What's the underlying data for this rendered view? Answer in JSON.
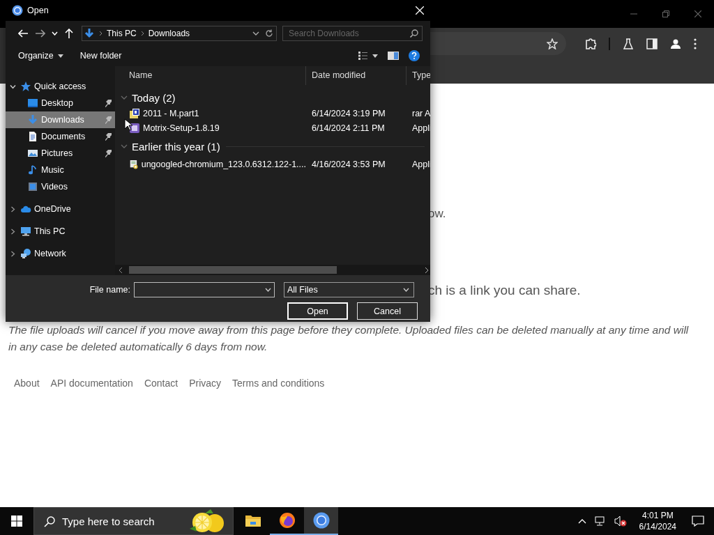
{
  "browser": {
    "page": {
      "fragments": [
        "ow.",
        "ch is a link you can share."
      ],
      "notice": "The file uploads will cancel if you move away from this page before they complete. Uploaded files can be deleted manually at any time and will in any case be deleted automatically 6 days from now.",
      "footer_links": [
        "About",
        "API documentation",
        "Contact",
        "Privacy",
        "Terms and conditions"
      ]
    }
  },
  "dialog": {
    "title": "Open",
    "breadcrumb": [
      "This PC",
      "Downloads"
    ],
    "search": {
      "placeholder": "Search Downloads"
    },
    "toolbar": [
      "Organize",
      "New folder"
    ],
    "nav": [
      {
        "label": "Quick access",
        "kind": "star",
        "expanded": true,
        "selected": false,
        "children": [
          {
            "label": "Desktop",
            "kind": "desktop",
            "pinned": true,
            "selected": false
          },
          {
            "label": "Downloads",
            "kind": "download",
            "pinned": true,
            "selected": true
          },
          {
            "label": "Documents",
            "kind": "document",
            "pinned": true,
            "selected": false
          },
          {
            "label": "Pictures",
            "kind": "picture",
            "pinned": true,
            "selected": false
          },
          {
            "label": "Music",
            "kind": "music",
            "pinned": false,
            "selected": false
          },
          {
            "label": "Videos",
            "kind": "video",
            "pinned": false,
            "selected": false
          }
        ]
      },
      {
        "label": "OneDrive",
        "kind": "cloud",
        "expanded": false,
        "selected": false
      },
      {
        "label": "This PC",
        "kind": "computer",
        "expanded": false,
        "selected": false
      },
      {
        "label": "Network",
        "kind": "network",
        "expanded": false,
        "selected": false
      }
    ],
    "columns": [
      "Name",
      "Date modified",
      "Type"
    ],
    "groups": [
      {
        "label": "Today (2)",
        "expanded": true,
        "files": [
          {
            "name": "2011 - M.part1",
            "kind": "archive",
            "date": "6/14/2024 3:19 PM",
            "type": "rar A",
            "selected": false
          },
          {
            "name": "Motrix-Setup-1.8.19",
            "kind": "installer",
            "date": "6/14/2024 2:11 PM",
            "type": "Appli",
            "selected": false
          }
        ]
      },
      {
        "label": "Earlier this year (1)",
        "expanded": true,
        "files": [
          {
            "name": "ungoogled-chromium_123.0.6312.122-1....",
            "kind": "setup",
            "date": "4/16/2024 3:53 PM",
            "type": "Appli",
            "selected": false
          }
        ]
      }
    ],
    "file_name_label": "File name:",
    "filter": "All Files",
    "buttons": [
      "Open",
      "Cancel"
    ]
  },
  "taskbar": {
    "search": {
      "placeholder": "Type here to search"
    },
    "apps": [
      {
        "kind": "folder",
        "running": false,
        "active": false
      },
      {
        "kind": "firefox",
        "running": true,
        "active": false
      },
      {
        "kind": "chrome",
        "running": true,
        "active": true
      }
    ],
    "time": "4:01 PM",
    "date": "6/14/2024"
  }
}
